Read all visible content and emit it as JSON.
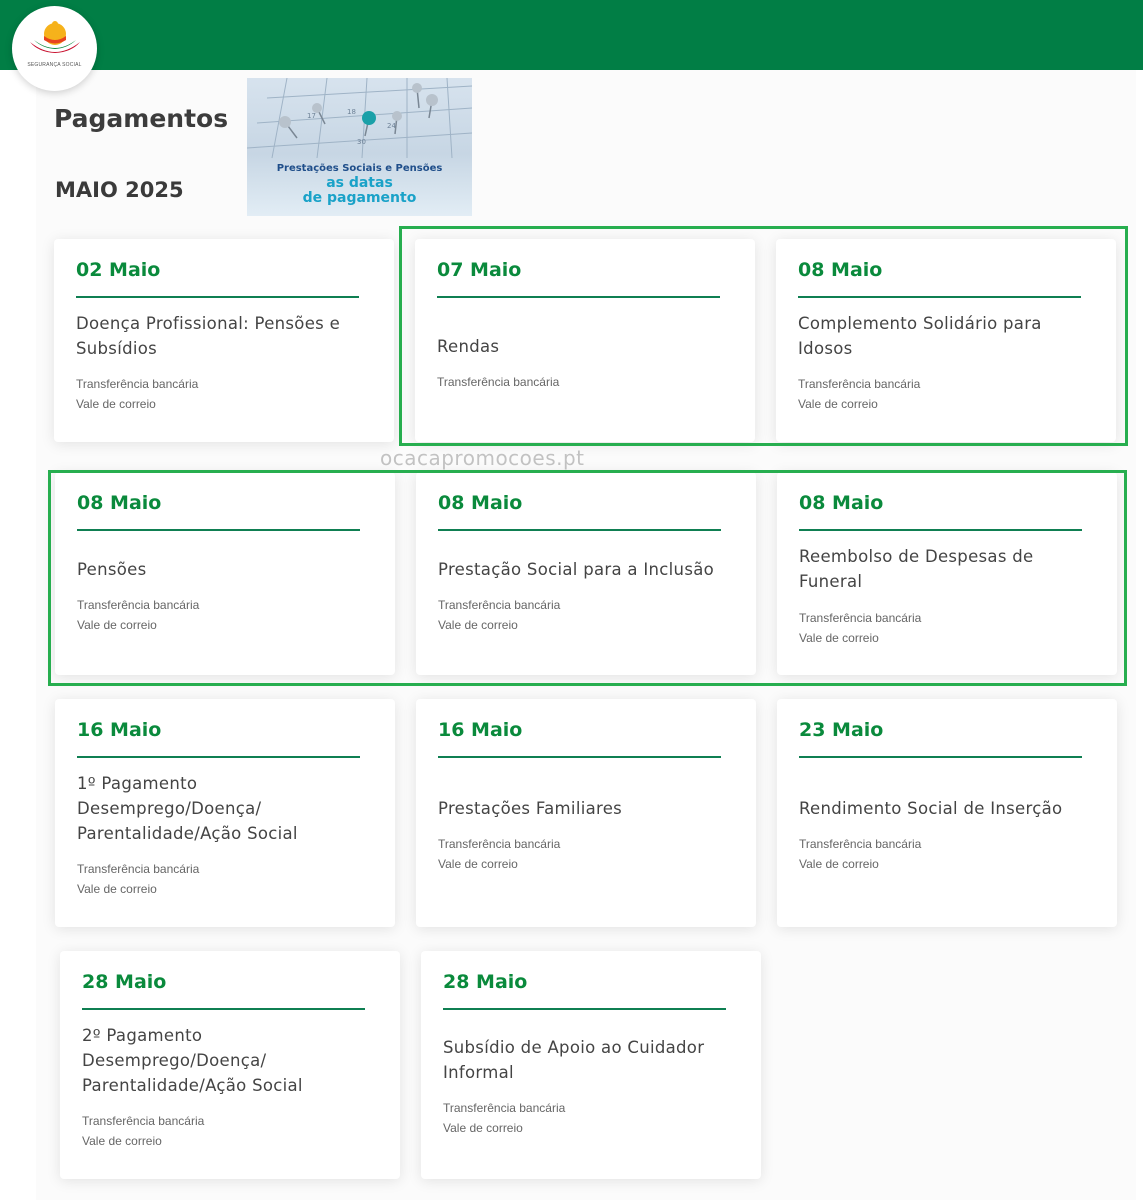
{
  "header": {
    "logo_text": "SEGURANÇA SOCIAL",
    "brand_color": "#017e45"
  },
  "page": {
    "title": "Pagamentos",
    "month": "MAIO 2025"
  },
  "banner": {
    "line1": "Prestações Sociais e Pensões",
    "line2": "as datas",
    "line3": "de pagamento"
  },
  "watermark": "ocacapromocoes.pt",
  "accent_color": "#0a8a3c",
  "highlight_color": "#27ae4f",
  "cards": [
    {
      "date": "02 Maio",
      "title": "Doença Profissional: Pensões e Subsídios",
      "methods": [
        "Transferência bancária",
        "Vale de correio"
      ]
    },
    {
      "date": "07 Maio",
      "title": "Rendas",
      "methods": [
        "Transferência bancária"
      ]
    },
    {
      "date": "08 Maio",
      "title": "Complemento Solidário para Idosos",
      "methods": [
        "Transferência bancária",
        "Vale de correio"
      ]
    },
    {
      "date": "08 Maio",
      "title": "Pensões",
      "methods": [
        "Transferência bancária",
        "Vale de correio"
      ]
    },
    {
      "date": "08 Maio",
      "title": "Prestação Social para a Inclusão",
      "methods": [
        "Transferência bancária",
        "Vale de correio"
      ]
    },
    {
      "date": "08 Maio",
      "title": "Reembolso de Despesas de Funeral",
      "methods": [
        "Transferência bancária",
        "Vale de correio"
      ]
    },
    {
      "date": "16 Maio",
      "title": "1º Pagamento Desemprego/Doença/ Parentalidade/Ação Social",
      "methods": [
        "Transferência bancária",
        "Vale de correio"
      ]
    },
    {
      "date": "16 Maio",
      "title": "Prestações Familiares",
      "methods": [
        "Transferência bancária",
        "Vale de correio"
      ]
    },
    {
      "date": "23 Maio",
      "title": "Rendimento Social de Inserção",
      "methods": [
        "Transferência bancária",
        "Vale de correio"
      ]
    },
    {
      "date": "28 Maio",
      "title": "2º Pagamento Desemprego/Doença/ Parentalidade/Ação Social",
      "methods": [
        "Transferência bancária",
        "Vale de correio"
      ]
    },
    {
      "date": "28 Maio",
      "title": "Subsídio de Apoio ao Cuidador Informal",
      "methods": [
        "Transferência bancária",
        "Vale de correio"
      ]
    }
  ]
}
